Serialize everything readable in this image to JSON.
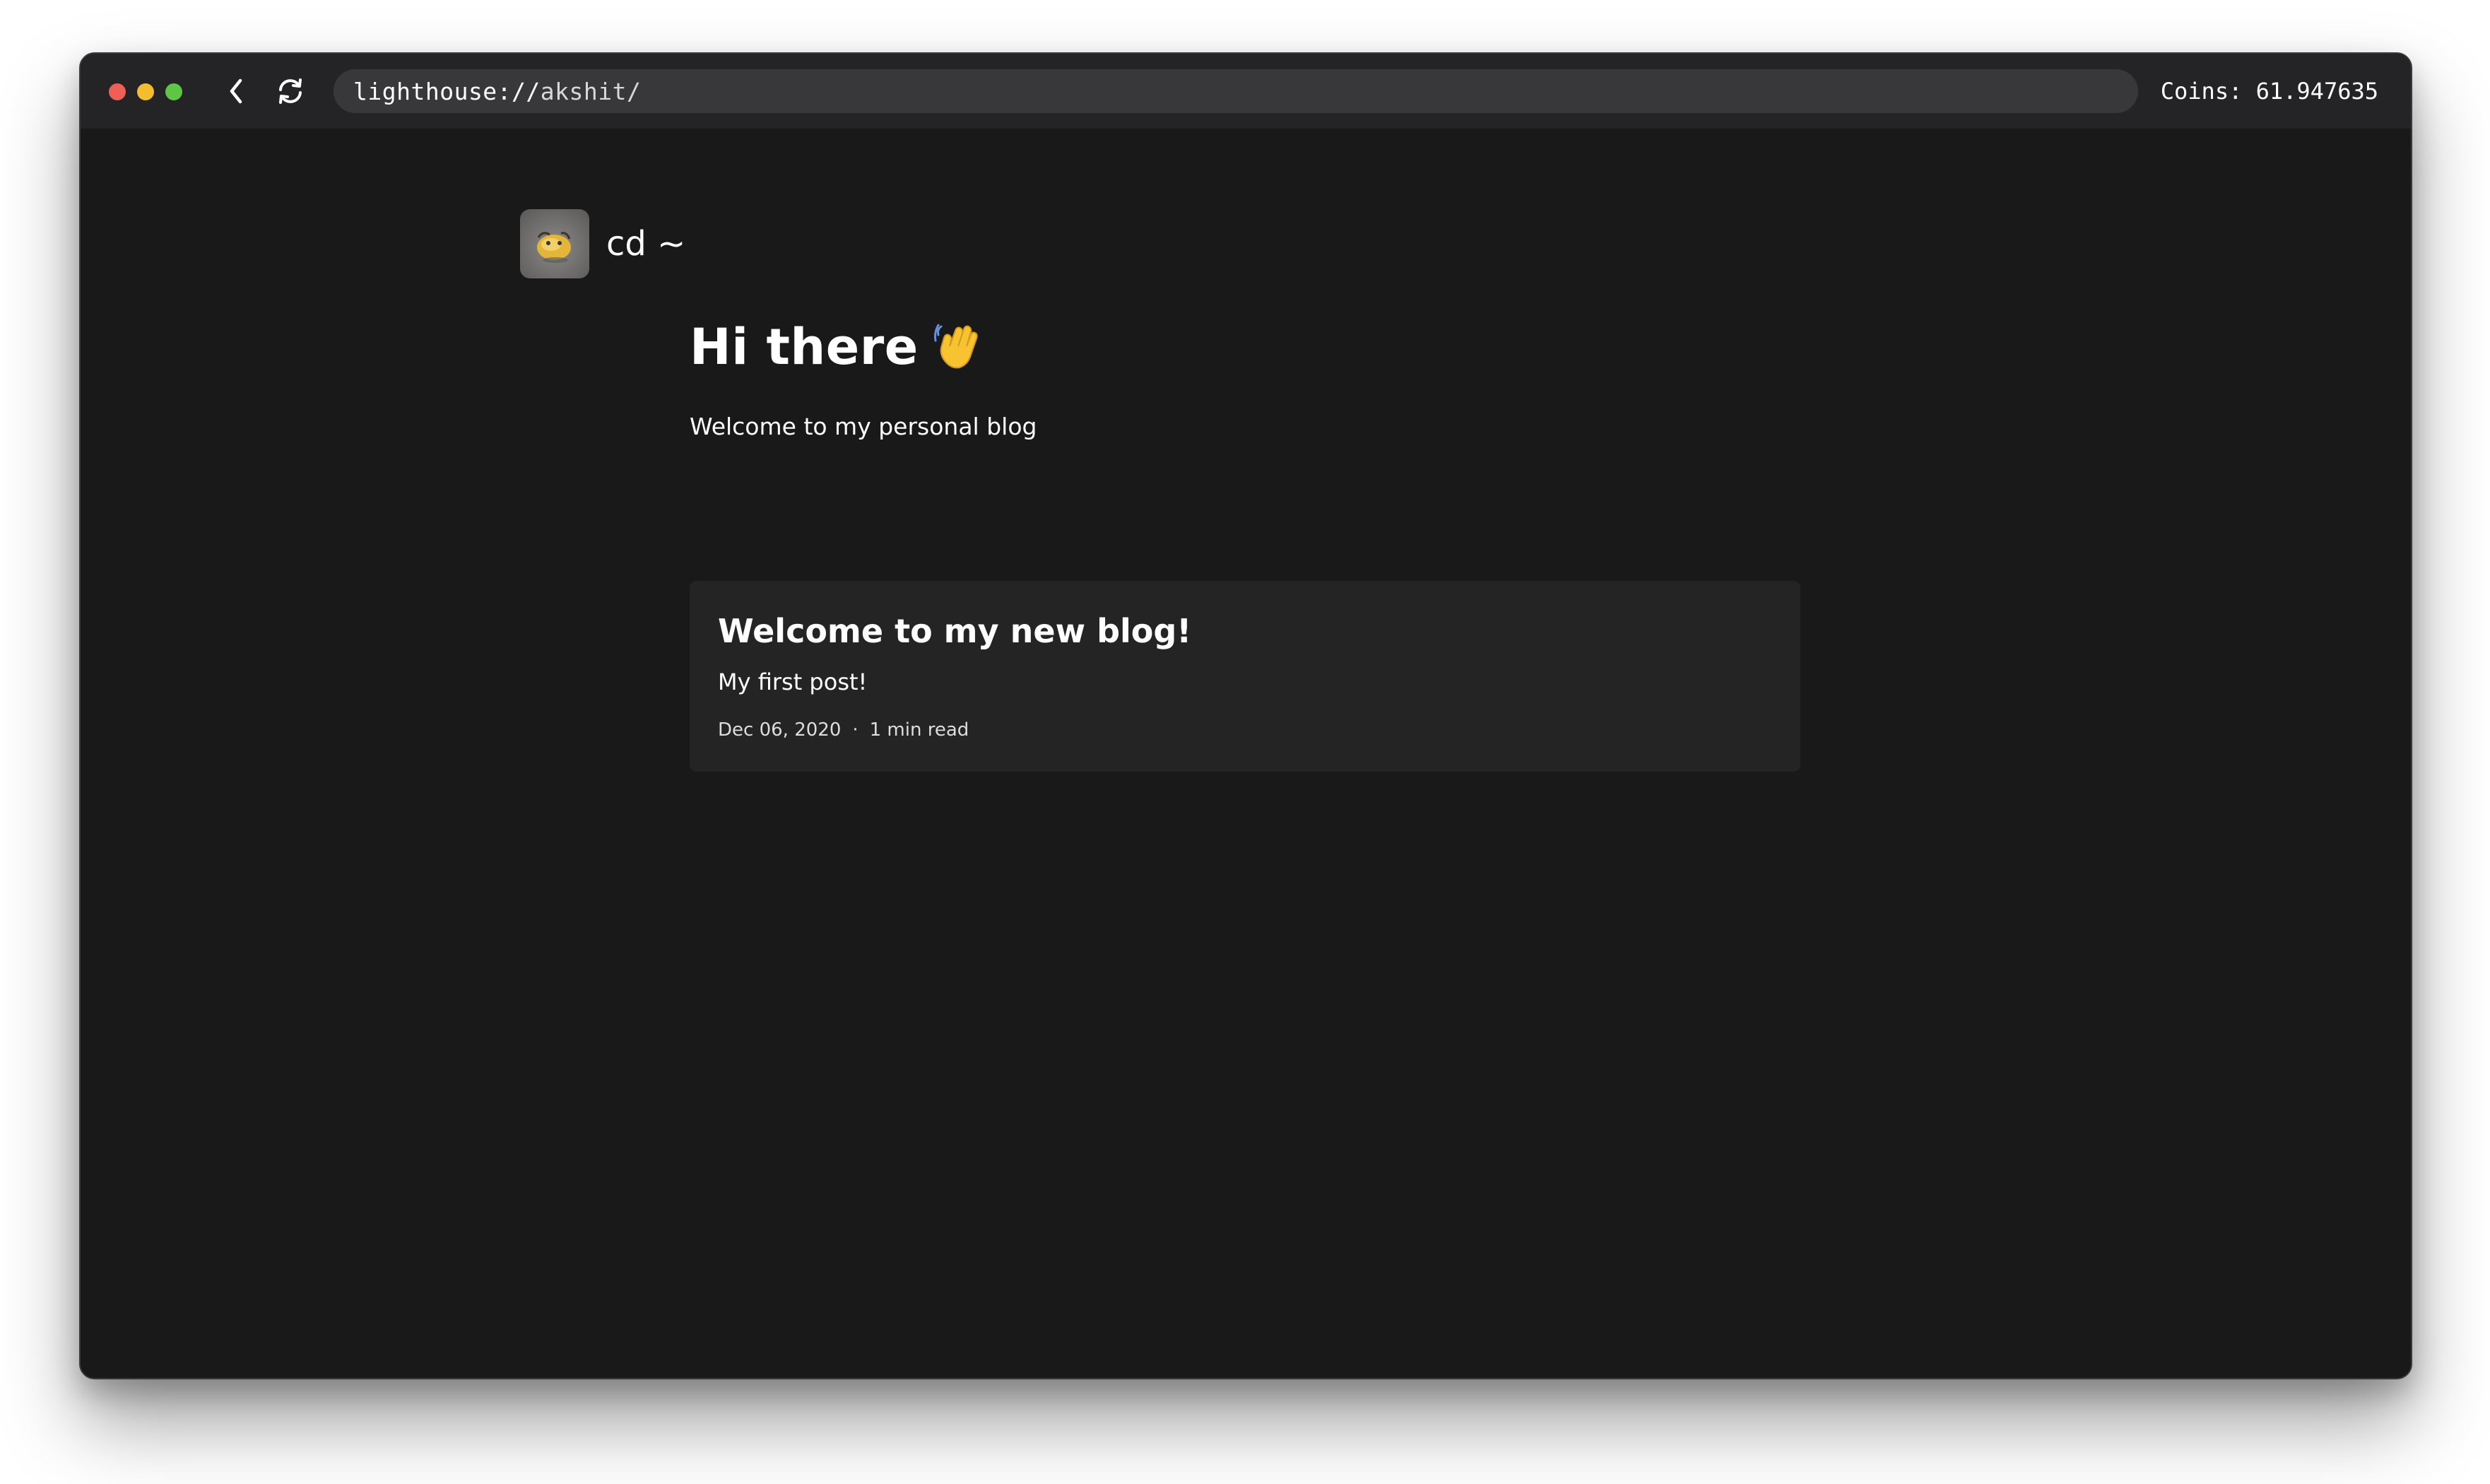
{
  "browser": {
    "url_scheme": "lighthouse://",
    "url_path": "akshit/",
    "coins": "Coins: 61.947635",
    "icons": {
      "back": "chevron-left-icon",
      "reload": "reload-icon"
    },
    "colors": {
      "traffic_red": "#ee5f57",
      "traffic_yellow": "#f4bc2f",
      "traffic_green": "#5fc545"
    }
  },
  "site": {
    "title": "cd ~",
    "avatar": "avatar-image"
  },
  "hero": {
    "title": "Hi there",
    "emoji": "waving-hand",
    "subtitle": "Welcome to my personal blog"
  },
  "posts": [
    {
      "title": "Welcome to my new blog!",
      "description": "My first post!",
      "date": "Dec 06, 2020",
      "separator": "·",
      "read_time": "1 min read"
    }
  ],
  "theme": {
    "page_background": "#191919",
    "card_background": "#242424",
    "titlebar_background": "#242426"
  }
}
